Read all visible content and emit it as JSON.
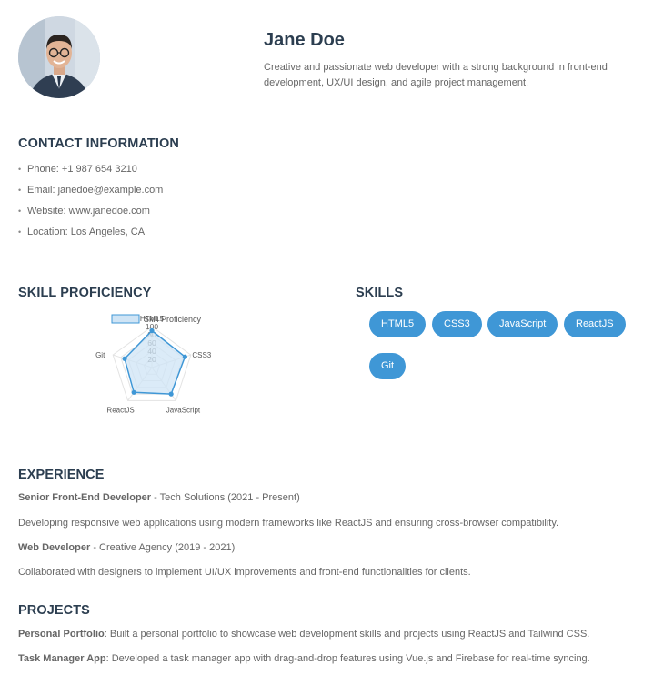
{
  "profile": {
    "name": "Jane Doe",
    "bio": "Creative and passionate web developer with a strong background in front-end development, UX/UI design, and agile project management."
  },
  "contact": {
    "title": "CONTACT INFORMATION",
    "items": [
      "Phone: +1 987 654 3210",
      "Email: janedoe@example.com",
      "Website: www.janedoe.com",
      "Location: Los Angeles, CA"
    ]
  },
  "skill_proficiency": {
    "title": "SKILL PROFICIENCY"
  },
  "skills": {
    "title": "SKILLS",
    "items": [
      "HTML5",
      "CSS3",
      "JavaScript",
      "ReactJS",
      "Git"
    ]
  },
  "experience": {
    "title": "EXPERIENCE",
    "entries": [
      {
        "role": "Senior Front-End Developer",
        "meta": " - Tech Solutions (2021 - Present)",
        "description": "Developing responsive web applications using modern frameworks like ReactJS and ensuring cross-browser compatibility."
      },
      {
        "role": "Web Developer",
        "meta": " - Creative Agency (2019 - 2021)",
        "description": "Collaborated with designers to implement UI/UX improvements and front-end functionalities for clients."
      }
    ]
  },
  "projects": {
    "title": "PROJECTS",
    "items": [
      {
        "name": "Personal Portfolio",
        "description": ": Built a personal portfolio to showcase web development skills and projects using ReactJS and Tailwind CSS."
      },
      {
        "name": "Task Manager App",
        "description": ": Developed a task manager app with drag-and-drop features using Vue.js and Firebase for real-time syncing."
      }
    ]
  },
  "colors": {
    "accent": "#3f97d6",
    "heading": "#2c3e50",
    "radar_fill": "#cfe4f5",
    "radar_stroke": "#3f97d6"
  },
  "chart_data": {
    "type": "radar",
    "legend": [
      "Skill Proficiency"
    ],
    "categories": [
      "HTML5",
      "CSS3",
      "JavaScript",
      "ReactJS",
      "Git"
    ],
    "series": [
      {
        "name": "Skill Proficiency",
        "values": [
          90,
          85,
          80,
          75,
          70
        ]
      }
    ],
    "r_ticks": [
      20,
      40,
      60,
      80,
      100
    ],
    "rlim": [
      0,
      100
    ]
  }
}
